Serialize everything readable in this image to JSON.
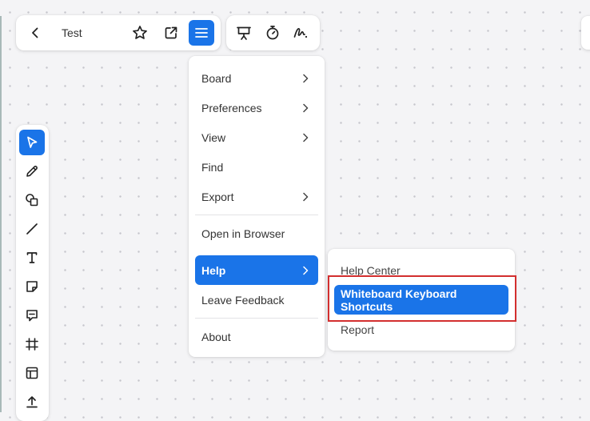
{
  "board": {
    "title": "Test"
  },
  "topbar": {
    "icons": [
      "back-chevron-icon",
      "star-icon",
      "open-external-icon",
      "hamburger-menu-icon"
    ],
    "secondary_icons": [
      "presentation-icon",
      "timer-icon",
      "signature-icon"
    ]
  },
  "left_toolbar": {
    "tools": [
      "select-pointer-icon",
      "pen-icon",
      "shapes-icon",
      "line-icon",
      "text-icon",
      "sticky-note-icon",
      "comment-icon",
      "frame-icon",
      "template-icon",
      "upload-icon"
    ]
  },
  "main_menu": {
    "items": [
      {
        "label": "Board",
        "has_submenu": true
      },
      {
        "label": "Preferences",
        "has_submenu": true
      },
      {
        "label": "View",
        "has_submenu": true
      },
      {
        "label": "Find",
        "has_submenu": false
      },
      {
        "label": "Export",
        "has_submenu": true
      },
      {
        "label": "Open in Browser",
        "has_submenu": false
      },
      {
        "label": "Help",
        "has_submenu": true,
        "active": true
      },
      {
        "label": "Leave Feedback",
        "has_submenu": false
      },
      {
        "label": "About",
        "has_submenu": false
      }
    ]
  },
  "help_submenu": {
    "items": [
      {
        "label": "Help Center"
      },
      {
        "label": "Whiteboard Keyboard Shortcuts",
        "active": true
      },
      {
        "label": "Report"
      }
    ]
  },
  "colors": {
    "accent": "#1a74e8",
    "highlight_border": "#d32f2f",
    "canvas_bg": "#f4f4f6"
  }
}
